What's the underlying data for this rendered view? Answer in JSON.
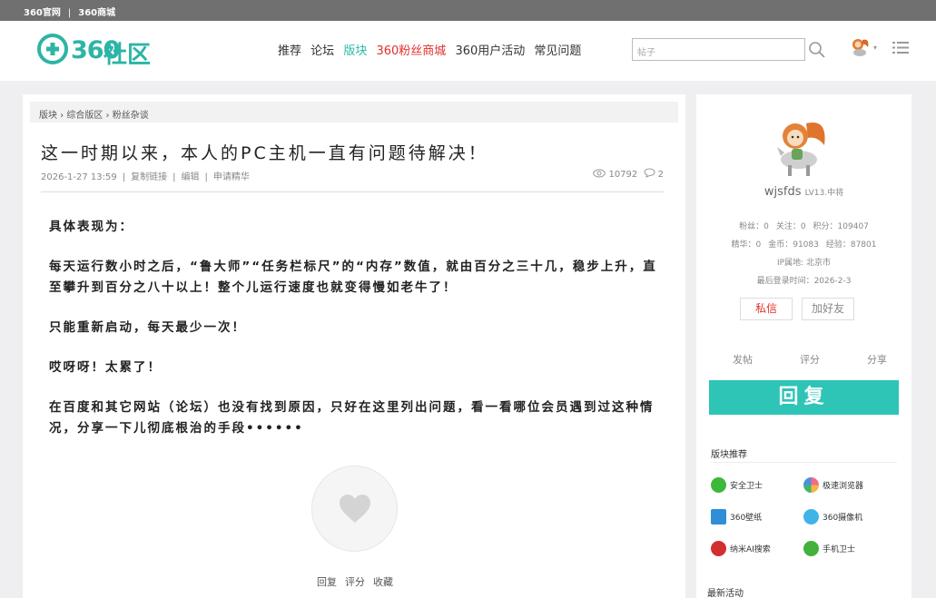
{
  "topbar": {
    "link1": "360官网",
    "sep": "|",
    "link2": "360商城"
  },
  "header": {
    "logo_text": "360社区",
    "nav": [
      "推荐",
      "论坛",
      "版块",
      "360粉丝商城",
      "360用户活动",
      "常见问题"
    ],
    "search_placeholder": "帖子"
  },
  "post": {
    "breadcrumb": "版块 › 综合版区 › 粉丝杂谈",
    "title": "这一时期以来，本人的PC主机一直有问题待解决！",
    "date": "2026-1-27 13:59",
    "copy_link": "复制链接",
    "edit": "编辑",
    "apply": "申请精华",
    "views": "10792",
    "comments": "2",
    "paragraphs": [
      "具体表现为：",
      "每天运行数小时之后，“鲁大师”“任务栏标尺”的“内存”数值，就由百分之三十几，稳步上升，直至攀升到百分之八十以上！整个儿运行速度也就变得慢如老牛了！",
      "只能重新启动，每天最少一次！",
      "哎呀呀！太累了！",
      "在百度和其它网站（论坛）也没有找到原因，只好在这里列出问题，看一看哪位会员遇到过这种情况，分享一下儿彻底根治的手段••••••"
    ],
    "actions": [
      "回复",
      "评分",
      "收藏"
    ]
  },
  "user": {
    "name": "wjsfds",
    "level": "LV13.中将",
    "row1": [
      "粉丝：0",
      "关注：0",
      "积分：109407"
    ],
    "row2": [
      "精华：0",
      "金币：91083",
      "经验：87801"
    ],
    "ip": "IP属地: 北京市",
    "last_login": "最后登录时间：2026-2-3",
    "msg_btn": "私信",
    "friend_btn": "加好友",
    "tabs": [
      "发帖",
      "评分",
      "分享"
    ],
    "reply_btn": "回复"
  },
  "recommend": {
    "title": "版块推荐",
    "items": [
      "安全卫士",
      "极速浏览器",
      "360壁纸",
      "360摄像机",
      "纳米AI搜索",
      "手机卫士"
    ],
    "colors": [
      "#3cb83a",
      "#f06a8a",
      "#2e8fd6",
      "#3fb4e8",
      "#d2302f",
      "#44b13d"
    ]
  },
  "latest": {
    "title": "最新活动"
  }
}
